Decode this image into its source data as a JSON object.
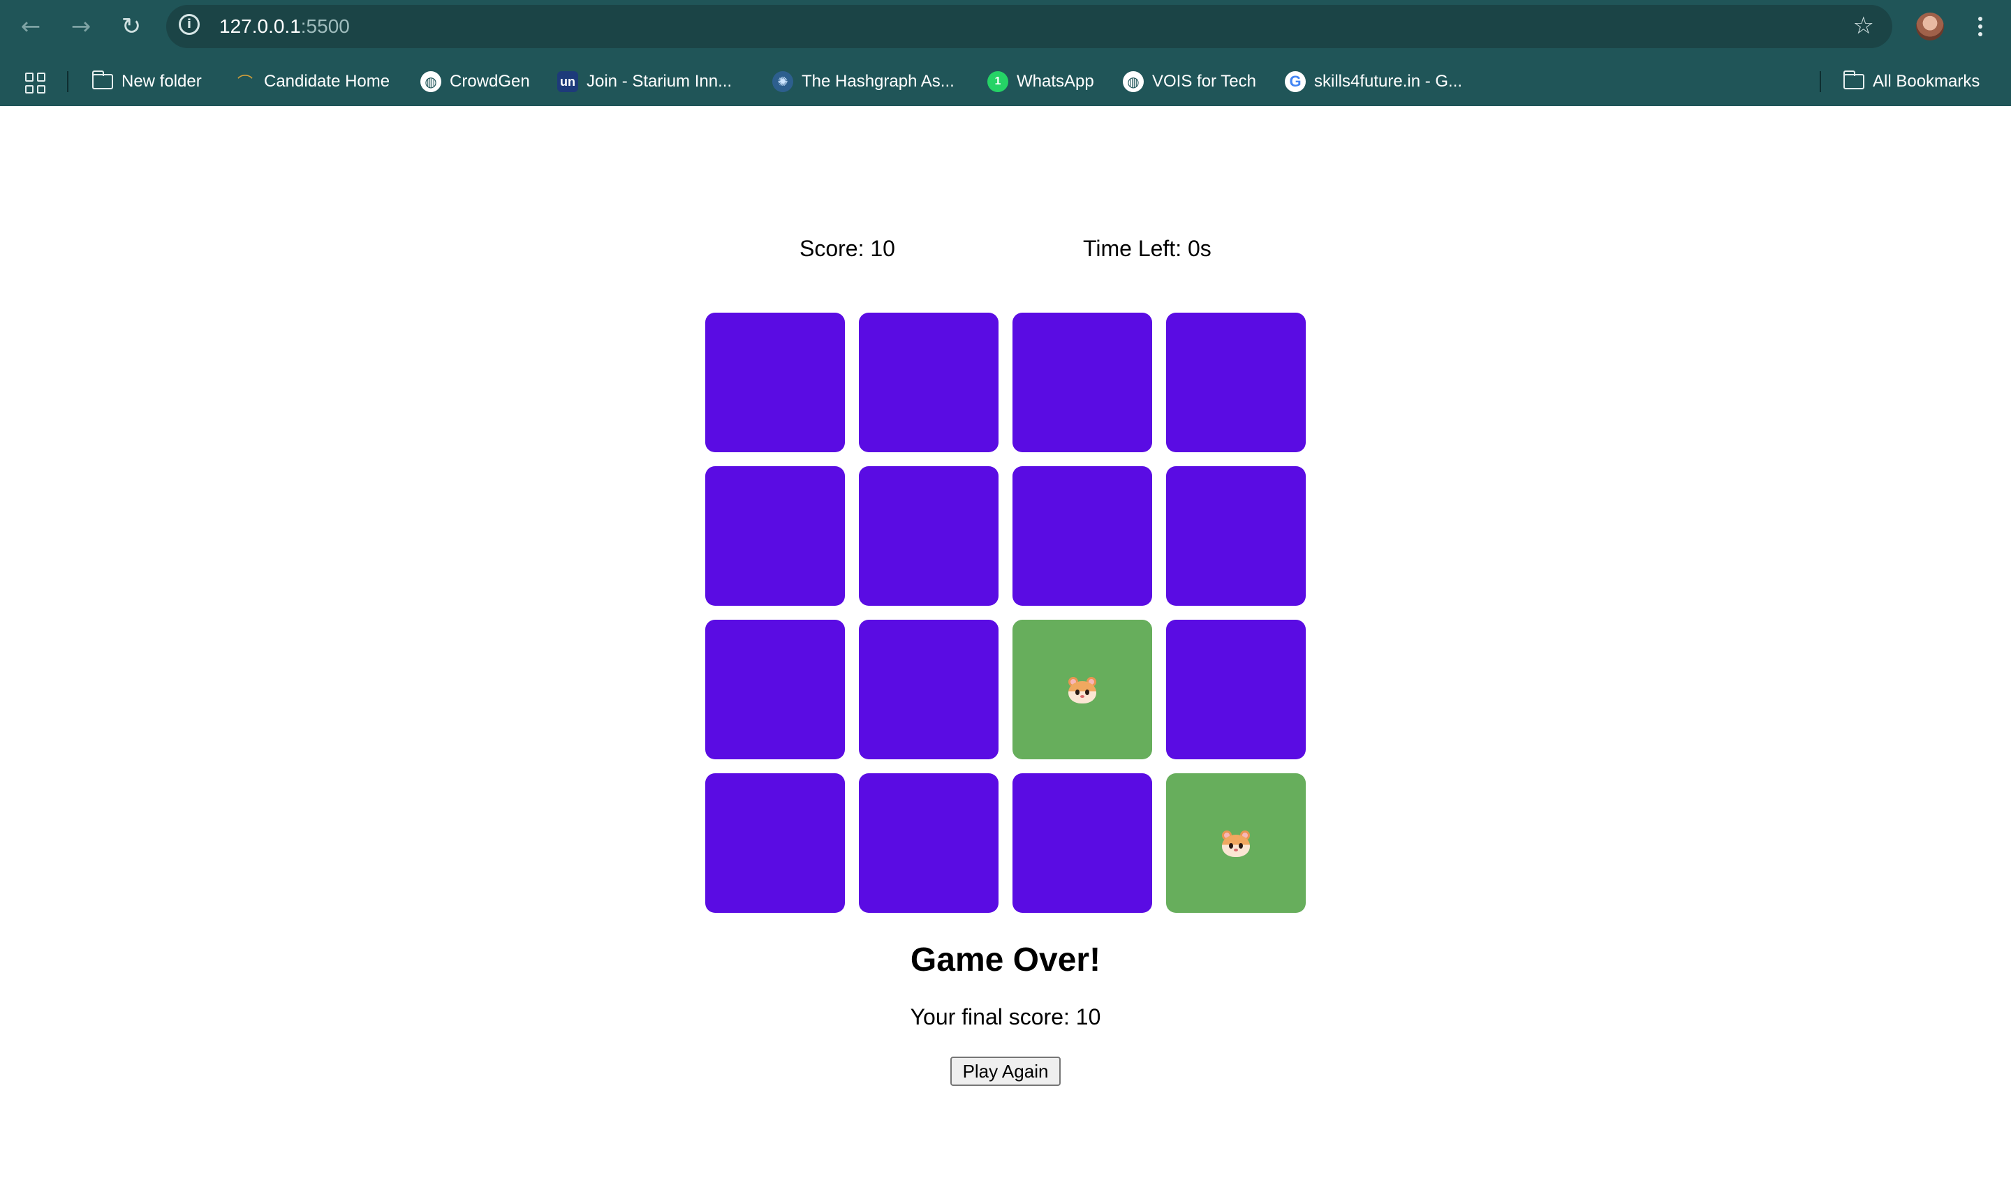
{
  "browser": {
    "url_host": "127.0.0.1",
    "url_port": ":5500",
    "bookmarks": [
      {
        "label": "New folder",
        "icon": "folder-icon"
      },
      {
        "label": "Candidate Home",
        "icon": "candidate-home-icon"
      },
      {
        "label": "CrowdGen",
        "icon": "globe-icon"
      },
      {
        "label": "Join - Starium Inn...",
        "icon": "un-icon"
      },
      {
        "label": "The Hashgraph As...",
        "icon": "hashgraph-icon"
      },
      {
        "label": "WhatsApp",
        "icon": "whatsapp-icon",
        "badge": "1"
      },
      {
        "label": "VOIS for Tech",
        "icon": "globe-icon"
      },
      {
        "label": "skills4future.in - G...",
        "icon": "google-icon"
      }
    ],
    "all_bookmarks": "All Bookmarks"
  },
  "game": {
    "score": "Score: 10",
    "time_left": "Time Left: 0s",
    "grid": {
      "rows": 4,
      "cols": 4,
      "hidden_color": "#5a0ce3",
      "revealed_color": "#67ae5c",
      "revealed_cells": [
        {
          "row": 3,
          "col": 3,
          "content": "hamster-icon"
        },
        {
          "row": 4,
          "col": 4,
          "content": "hamster-icon"
        }
      ]
    },
    "game_over_title": "Game Over!",
    "final_score": "Your final score: 10",
    "play_again_label": "Play Again"
  }
}
